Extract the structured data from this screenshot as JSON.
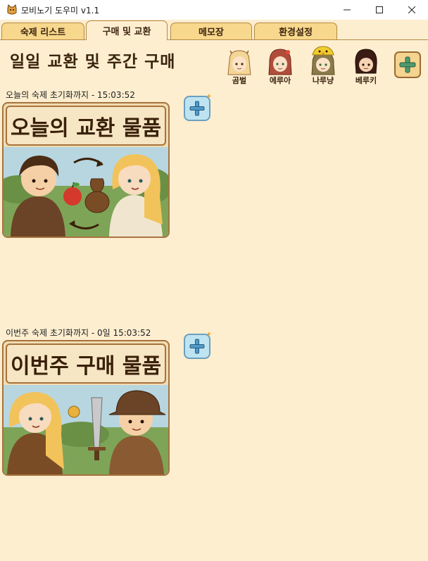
{
  "window": {
    "title": "모비노기 도우미 v1.1"
  },
  "tabs": [
    {
      "label": "숙제 리스트",
      "active": false
    },
    {
      "label": "구매 및 교환",
      "active": true
    },
    {
      "label": "메모장",
      "active": false
    },
    {
      "label": "환경설정",
      "active": false
    }
  ],
  "page": {
    "title": "일일 교환 및 주간 구매"
  },
  "characters": [
    {
      "name": "곰벌"
    },
    {
      "name": "에루아"
    },
    {
      "name": "나루냥"
    },
    {
      "name": "베루키"
    }
  ],
  "daily": {
    "timer": "오늘의 숙제 초기화까지 - 15:03:52",
    "banner": "오늘의 교환 물품"
  },
  "weekly": {
    "timer": "이번주 숙제 초기화까지 - 0일 15:03:52",
    "banner": "이번주 구매 물품"
  },
  "icons": {
    "app": "cat-icon",
    "add": "plus-icon"
  },
  "colors": {
    "background": "#fdeed0",
    "tab": "#f7d88d",
    "plus_button": "#bfe4f1",
    "text": "#3b240e"
  }
}
